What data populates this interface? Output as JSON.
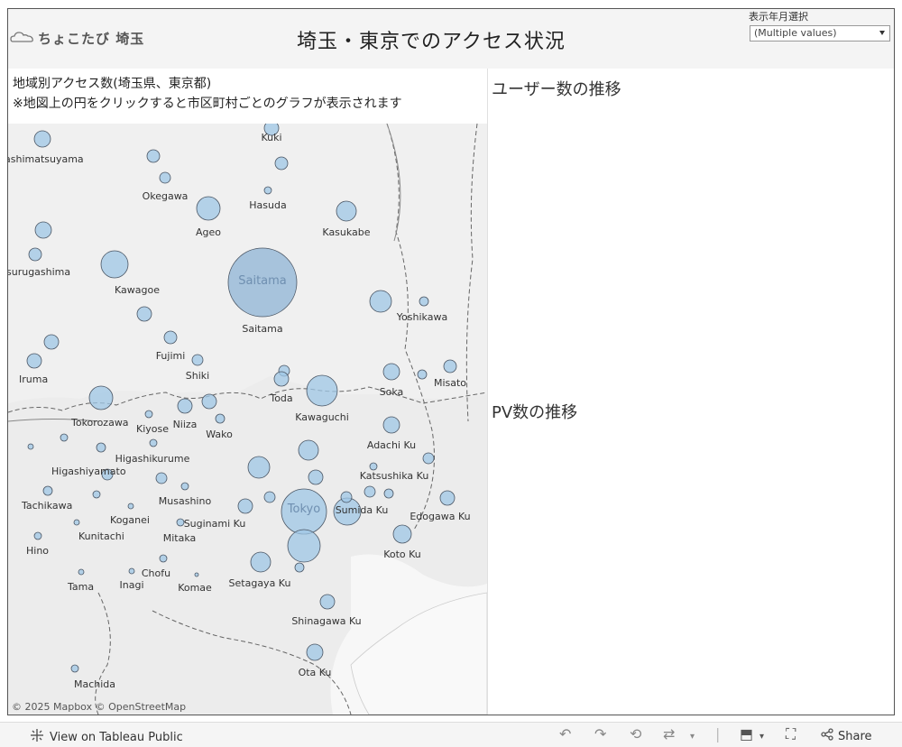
{
  "header": {
    "logo_text": "ちょこたび 埼玉",
    "title": "埼玉・東京でのアクセス状況",
    "filter_label": "表示年月選択",
    "filter_value": "(Multiple values)"
  },
  "map": {
    "caption_line1": "地域別アクセス数(埼玉県、東京都)",
    "caption_line2": "※地図上の円をクリックすると市区町村ごとのグラフが表示されます",
    "attribution": "© 2025 Mapbox  © OpenStreetMap",
    "labels": [
      "Kuki",
      "ashimatsuyama",
      "Okegawa",
      "Hasuda",
      "Ageo",
      "Kasukabe",
      "surugashima",
      "Kawagoe",
      "Saitama",
      "Saitama",
      "Yoshikawa",
      "Fujimi",
      "Shiki",
      "Iruma",
      "Toda",
      "Soka",
      "Misato",
      "Kawaguchi",
      "Tokorozawa",
      "Kiyose",
      "Niiza",
      "Wako",
      "Adachi Ku",
      "Higashiyamato",
      "Higashikurume",
      "Katsushika Ku",
      "Tachikawa",
      "Musashino",
      "Tokyo",
      "Koganei",
      "Suginami Ku",
      "Sumida Ku",
      "Edogawa Ku",
      "Kunitachi",
      "Mitaka",
      "Hino",
      "Koto Ku",
      "Chofu",
      "Tama",
      "Inagi",
      "Komae",
      "Setagaya Ku",
      "Shinagawa Ku",
      "Ota Ku",
      "Machida"
    ],
    "bubble_color": "#9fc7e6"
  },
  "panels": {
    "users_title": "ユーザー数の推移",
    "pv_title": "PV数の推移"
  },
  "toolbar": {
    "view_label": "View on Tableau Public",
    "share_label": "Share",
    "icons": [
      "undo-icon",
      "redo-icon",
      "revert-icon",
      "refresh-icon",
      "download-icon",
      "fullscreen-icon",
      "share-icon"
    ]
  }
}
